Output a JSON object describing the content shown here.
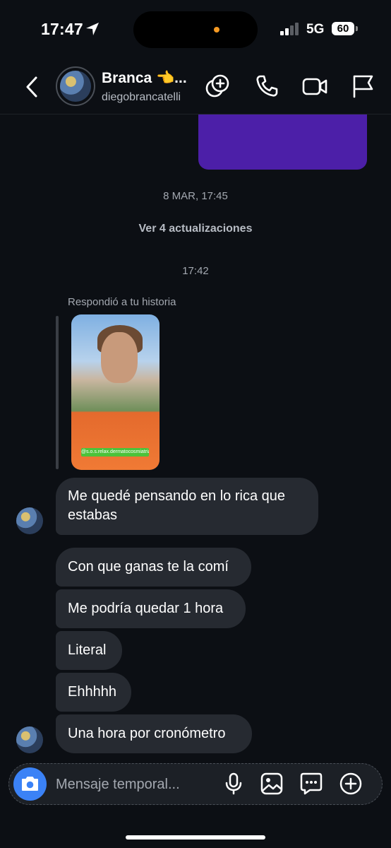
{
  "status_bar": {
    "time": "17:47",
    "network": "5G",
    "battery": "60"
  },
  "header": {
    "name": "Branca 👈...",
    "username": "diegobrancatelli",
    "icons": [
      "back-icon",
      "add-people-icon",
      "phone-icon",
      "video-icon",
      "flag-icon"
    ]
  },
  "thread": {
    "timestamp_1": "8 MAR, 17:45",
    "updates_link": "Ver 4 actualizaciones",
    "timestamp_2": "17:42",
    "story_reply_label": "Respondió a tu historia",
    "story_tag": "@s.o.s.relax.dermatocosmiatria",
    "messages": [
      "Me quedé pensando en lo rica que estabas",
      "Con que ganas te la comí",
      "Me podría quedar 1 hora",
      "Literal",
      "Ehhhhh",
      "Una hora por cronómetro"
    ]
  },
  "composer": {
    "placeholder": "Mensaje temporal...",
    "icons": [
      "camera-icon",
      "microphone-icon",
      "gallery-icon",
      "sticker-icon",
      "plus-icon"
    ]
  },
  "colors": {
    "background": "#0c0f14",
    "bubble": "#262a31",
    "accent": "#3b82f6",
    "sent_bubble": "#4c1fa8"
  }
}
